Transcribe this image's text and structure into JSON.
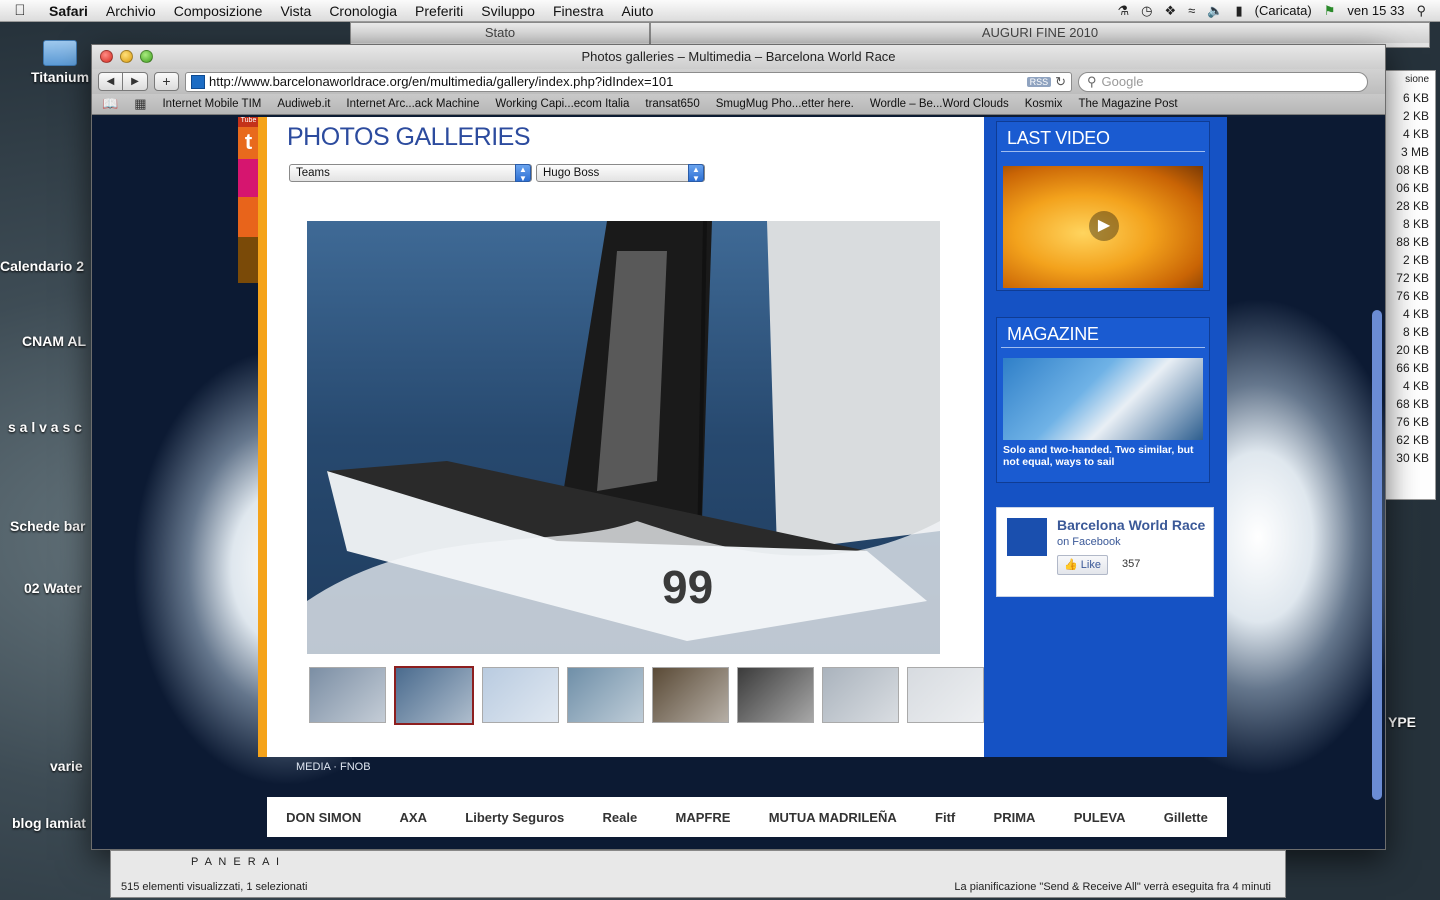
{
  "menubar": {
    "app": "Safari",
    "items": [
      "Archivio",
      "Composizione",
      "Vista",
      "Cronologia",
      "Preferiti",
      "Sviluppo",
      "Finestra",
      "Aiuto"
    ],
    "battery": "(Caricata)",
    "clock": "ven 15 33"
  },
  "desktop": {
    "icons": [
      "Titanium",
      "Calendario 2",
      "CNAM AL",
      "s a l v a s c",
      "Schede bar",
      "02 Water",
      "varie",
      "blog lamiat"
    ],
    "back_window_title": "Stato",
    "back_window2_title": "AUGURI FINE 2010",
    "back_window3_fragment": "YPE",
    "right_panel_header": "sione",
    "right_panel_rows": [
      "6 KB",
      "2 KB",
      "4 KB",
      "3 MB",
      "08 KB",
      "06 KB",
      "28 KB",
      "8 KB",
      "88 KB",
      "2 KB",
      "72 KB",
      "76 KB",
      "4 KB",
      "8 KB",
      "20 KB",
      "66 KB",
      "4 KB",
      "68 KB",
      "76 KB",
      "62 KB",
      "30 KB"
    ]
  },
  "safari": {
    "window_title": "Photos galleries – Multimedia – Barcelona World Race",
    "url": "http://www.barcelonaworldrace.org/en/multimedia/gallery/index.php?idIndex=101",
    "rss_label": "RSS",
    "search_placeholder": "Google",
    "bookmarks": [
      "Internet Mobile TIM",
      "Audiweb.it",
      "Internet Arc...ack Machine",
      "Working Capi...ecom Italia",
      "transat650",
      "SmugMug Pho...etter here.",
      "Wordle – Be...Word Clouds",
      "Kosmix",
      "The Magazine Post"
    ]
  },
  "page": {
    "title": "PHOTOS GALLERIES",
    "select_category": "Teams",
    "select_team": "Hugo Boss",
    "main_photo_text": "99",
    "credits": "MEDIA · FNOB",
    "thumbnails": [
      {
        "label": "thumb-1",
        "color": "#7b8ea4",
        "selected": false
      },
      {
        "label": "thumb-2",
        "color": "#4a6b8e",
        "selected": true
      },
      {
        "label": "thumb-3",
        "color": "#b9cbe0",
        "selected": false
      },
      {
        "label": "thumb-4",
        "color": "#6f8fa8",
        "selected": false
      },
      {
        "label": "thumb-5",
        "color": "#5a4a36",
        "selected": false
      },
      {
        "label": "thumb-6",
        "color": "#3b3b3b",
        "selected": false
      },
      {
        "label": "thumb-7",
        "color": "#aab3bd",
        "selected": false
      },
      {
        "label": "thumb-8",
        "color": "#d7dbe0",
        "selected": false
      }
    ],
    "social": {
      "youtube": "Tube",
      "twitter": "t"
    }
  },
  "sidebar": {
    "last_video_title": "LAST VIDEO",
    "magazine_title": "MAGAZINE",
    "magazine_caption": "Solo and two-handed. Two similar, but not equal, ways to sail",
    "facebook": {
      "name": "Barcelona World Race",
      "suffix": "on Facebook",
      "like_label": "Like",
      "like_count": "357"
    }
  },
  "sponsors": [
    "DON SIMON",
    "AXA",
    "Liberty Seguros",
    "Reale",
    "MAPFRE",
    "MUTUA MADRILEÑA",
    "Fitf",
    "PRIMA",
    "PULEVA",
    "Gillette"
  ],
  "finder": {
    "folder": "P A N E R A I",
    "status": "515 elementi visualizzati, 1 selezionati",
    "schedule": "La pianificazione \"Send & Receive All\" verrà eseguita fra 4 minuti"
  },
  "colors": {
    "site_blue": "#1552c4",
    "site_orange": "#f5a31a",
    "title_blue": "#2c4b9e"
  }
}
